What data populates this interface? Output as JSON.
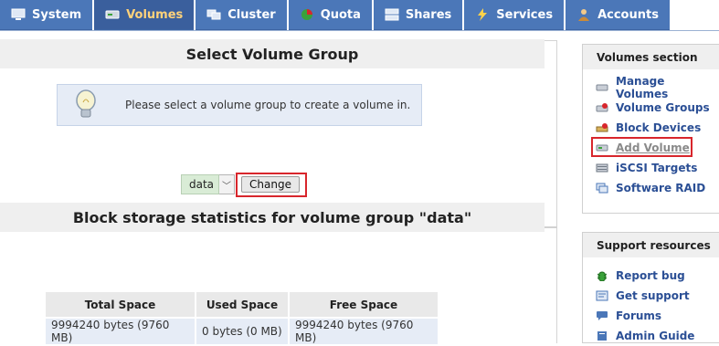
{
  "tabs": [
    {
      "label": "System",
      "icon": "system-icon",
      "active": false
    },
    {
      "label": "Volumes",
      "icon": "volumes-icon",
      "active": true
    },
    {
      "label": "Cluster",
      "icon": "cluster-icon",
      "active": false
    },
    {
      "label": "Quota",
      "icon": "quota-icon",
      "active": false
    },
    {
      "label": "Shares",
      "icon": "shares-icon",
      "active": false
    },
    {
      "label": "Services",
      "icon": "services-icon",
      "active": false
    },
    {
      "label": "Accounts",
      "icon": "accounts-icon",
      "active": false
    }
  ],
  "select_section": {
    "title": "Select Volume Group",
    "info_message": "Please select a volume group to create a volume in.",
    "selected_group": "data",
    "change_label": "Change"
  },
  "stats_section": {
    "title": "Block storage statistics for volume group \"data\"",
    "headers": [
      "Total Space",
      "Used Space",
      "Free Space"
    ],
    "row": [
      "9994240 bytes (9760 MB)",
      "0 bytes (0 MB)",
      "9994240 bytes (9760 MB)"
    ]
  },
  "volumes_panel": {
    "title": "Volumes section",
    "items": [
      {
        "label": "Manage Volumes",
        "icon": "disk-icon"
      },
      {
        "label": "Volume Groups",
        "icon": "volume-groups-icon"
      },
      {
        "label": "Block Devices",
        "icon": "block-devices-icon"
      },
      {
        "label": "Add Volume",
        "icon": "add-volume-icon",
        "current": true
      },
      {
        "label": "iSCSI Targets",
        "icon": "iscsi-icon"
      },
      {
        "label": "Software RAID",
        "icon": "raid-icon"
      }
    ]
  },
  "support_panel": {
    "title": "Support resources",
    "items": [
      {
        "label": "Report bug",
        "icon": "bug-icon"
      },
      {
        "label": "Get support",
        "icon": "support-icon"
      },
      {
        "label": "Forums",
        "icon": "forums-icon"
      },
      {
        "label": "Admin Guide",
        "icon": "guide-icon"
      }
    ]
  },
  "colors": {
    "tab_bg": "#4b77b8",
    "active_tab_text": "#ffd27a",
    "link": "#2b4f95",
    "highlight": "#d8262c"
  }
}
